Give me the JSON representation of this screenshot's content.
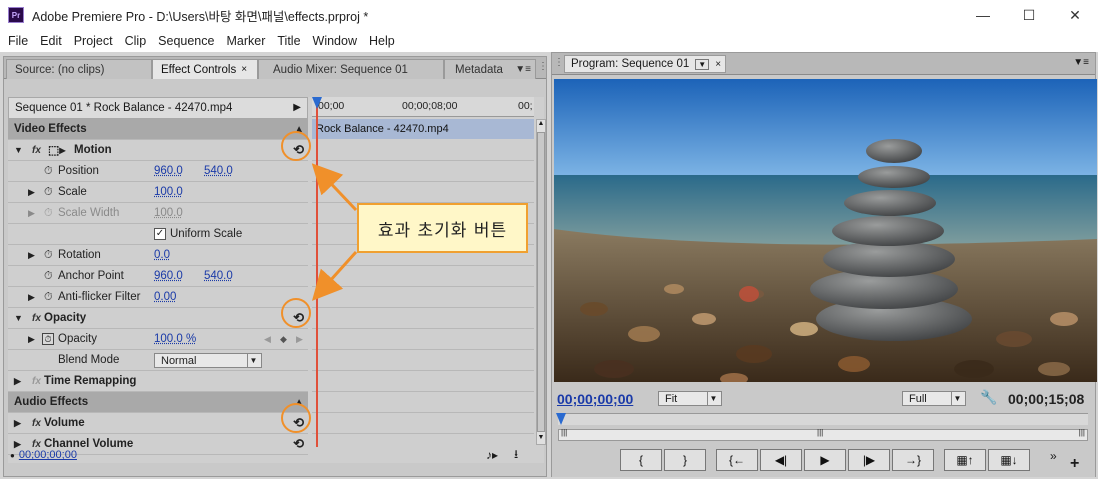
{
  "window": {
    "app_icon": "Pr",
    "title": "Adobe Premiere Pro - D:\\Users\\바탕 화면\\패널\\effects.prproj *"
  },
  "menu": [
    "File",
    "Edit",
    "Project",
    "Clip",
    "Sequence",
    "Marker",
    "Title",
    "Window",
    "Help"
  ],
  "left_tabs": {
    "source": "Source: (no clips)",
    "effect_controls": "Effect Controls",
    "audio_mixer": "Audio Mixer: Sequence 01",
    "metadata": "Metadata"
  },
  "effect_controls": {
    "header": "Sequence 01 * Rock Balance - 42470.mp4",
    "video_effects": "Video Effects",
    "motion": "Motion",
    "position_label": "Position",
    "position_x": "960.0",
    "position_y": "540.0",
    "scale_label": "Scale",
    "scale_value": "100.0",
    "scale_width_label": "Scale Width",
    "scale_width_value": "100.0",
    "uniform_scale": "Uniform Scale",
    "rotation_label": "Rotation",
    "rotation_value": "0.0",
    "anchor_label": "Anchor Point",
    "anchor_x": "960.0",
    "anchor_y": "540.0",
    "antiflicker_label": "Anti-flicker Filter",
    "antiflicker_value": "0.00",
    "opacity_section": "Opacity",
    "opacity_label": "Opacity",
    "opacity_value": "100.0 %",
    "blend_label": "Blend Mode",
    "blend_value": "Normal",
    "time_remap": "Time Remapping",
    "audio_effects": "Audio Effects",
    "volume": "Volume",
    "channel_volume": "Channel Volume",
    "footer_timecode": "00;00;00;00",
    "fx": "fx"
  },
  "timeline": {
    "t_start": "00;00",
    "t_mid": "00;00;08;00",
    "t_end": "00;",
    "clip": "Rock Balance - 42470.mp4"
  },
  "program": {
    "tab": "Program: Sequence 01",
    "current_tc": "00;00;00;00",
    "fit": "Fit",
    "quality": "Full",
    "duration_tc": "00;00;15;08"
  },
  "annotation": {
    "text": "효과 초기화 버튼"
  },
  "icons": {
    "reset": "reset-icon",
    "stopwatch": "stopwatch-icon"
  },
  "colors": {
    "accent_orange": "#f0902a",
    "callout_bg": "#fff7c8",
    "timecode_blue": "#1a3aa8",
    "playhead_red": "#e0503a"
  }
}
